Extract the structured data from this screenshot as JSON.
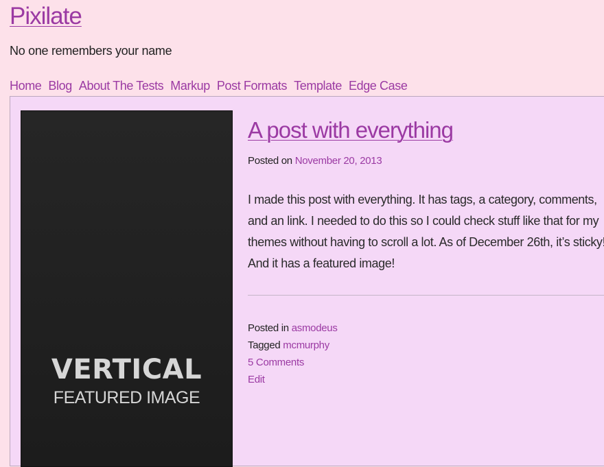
{
  "site": {
    "title": "Pixilate",
    "tagline": "No one remembers your name"
  },
  "nav": {
    "items": [
      "Home",
      "Blog",
      "About The Tests",
      "Markup",
      "Post Formats",
      "Template",
      "Edge Case"
    ]
  },
  "featured_image": {
    "line1": "VERTICAL",
    "line2": "FEATURED IMAGE"
  },
  "post": {
    "title": "A post with everything",
    "posted_on_label": "Posted on",
    "date": "November 20, 2013",
    "body": "I made this post with everything. It has tags, a category, comments, and an link. I needed to do this so I could check stuff like that for my themes without having to scroll a lot. As of December 26th, it’s sticky! And it has a featured image!",
    "posted_in_label": "Posted in",
    "category": "asmodeus",
    "tagged_label": "Tagged",
    "tag": "mcmurphy",
    "comments": "5 Comments",
    "edit": "Edit"
  },
  "colors": {
    "page_background": "#fde1ea",
    "content_background": "#f5d8f7",
    "link": "#9b3aa3",
    "image_background": "#222222"
  }
}
